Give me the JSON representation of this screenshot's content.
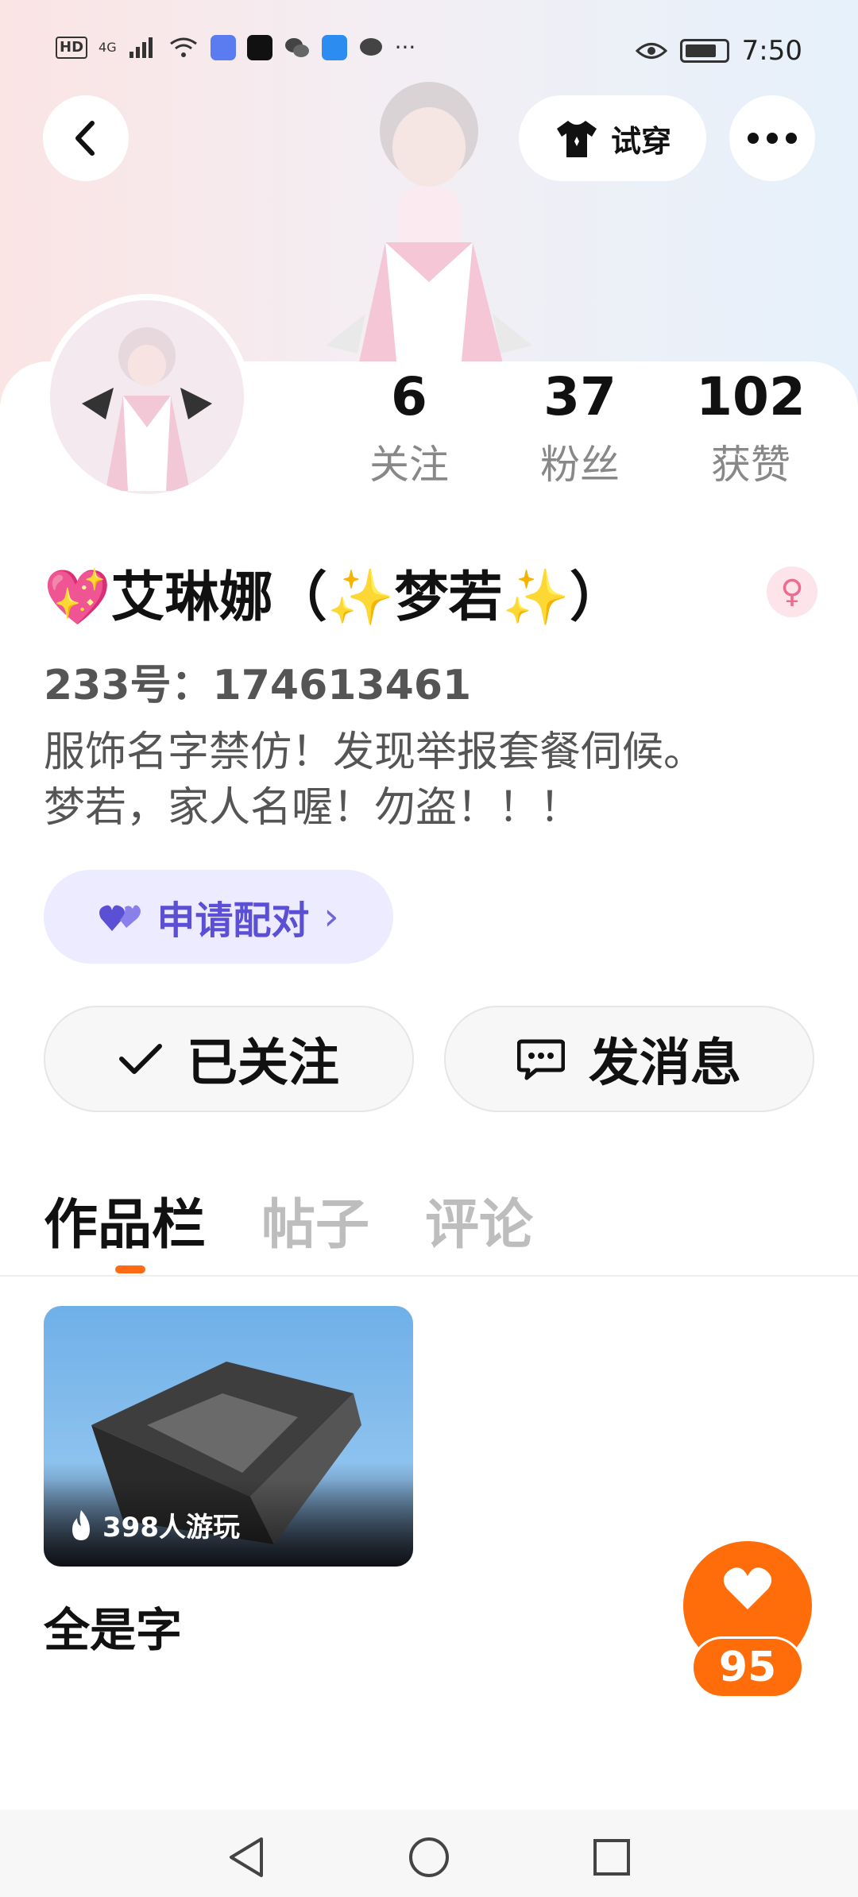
{
  "status_bar": {
    "hd": "HD",
    "network": "4G",
    "more": "···",
    "time": "7:50"
  },
  "header": {
    "tryon_label": "试穿"
  },
  "stats": [
    {
      "value": "6",
      "label": "关注"
    },
    {
      "value": "37",
      "label": "粉丝"
    },
    {
      "value": "102",
      "label": "获赞"
    }
  ],
  "profile": {
    "name": "💖艾琳娜（✨梦若✨）",
    "gender_symbol": "♀",
    "uid": "233号：174613461",
    "bio_line1": "服饰名字禁仿！发现举报套餐伺候。",
    "bio_line2": "梦若，家人名喔！勿盗！！！"
  },
  "pair_button": {
    "label": "申请配对",
    "chevron": "›"
  },
  "actions": {
    "follow_label": "已关注",
    "message_label": "发消息"
  },
  "tabs": [
    {
      "label": "作品栏",
      "active": true
    },
    {
      "label": "帖子",
      "active": false
    },
    {
      "label": "评论",
      "active": false
    }
  ],
  "works": [
    {
      "title": "全是字",
      "plays": "398人游玩"
    }
  ],
  "like_fab": {
    "count": "95"
  },
  "colors": {
    "accent_orange": "#ff6d0a",
    "pair_purple": "#5b4fd6",
    "pair_bg": "#ecebff"
  }
}
